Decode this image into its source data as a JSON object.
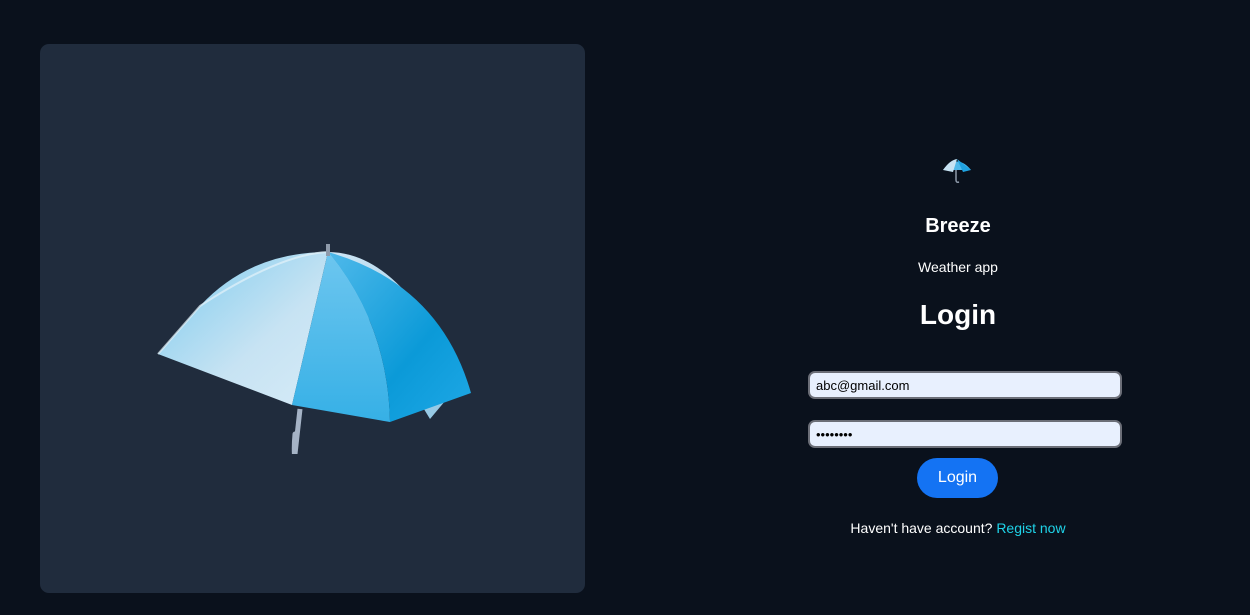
{
  "hero": {
    "image": "umbrella-illustration"
  },
  "brand": {
    "logo_icon": "umbrella-icon",
    "name": "Breeze",
    "tagline": "Weather app"
  },
  "login": {
    "heading": "Login",
    "email_value": "abc@gmail.com",
    "password_value": "password",
    "button_label": "Login",
    "register_prompt": "Haven't have account?",
    "register_link": "Regist now"
  },
  "colors": {
    "background": "#0a111c",
    "panel": "#202c3d",
    "button": "#1473f3",
    "link": "#1fd3e8",
    "input": "#e8f0fe"
  }
}
